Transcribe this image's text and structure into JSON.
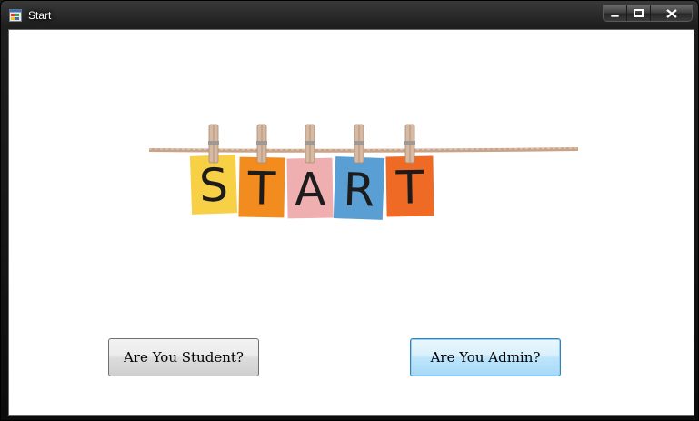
{
  "window": {
    "title": "Start",
    "icon": "app-form-icon"
  },
  "caption_buttons": {
    "minimize": "minimize-icon",
    "maximize": "maximize-icon",
    "close": "close-icon"
  },
  "hero": {
    "letters": [
      "S",
      "T",
      "A",
      "R",
      "T"
    ],
    "card_colors": [
      "#f7d046",
      "#f28c1e",
      "#efaeb0",
      "#5a9fd4",
      "#ef6a25"
    ]
  },
  "buttons": {
    "student": "Are You Student?",
    "admin": "Are You Admin?"
  }
}
